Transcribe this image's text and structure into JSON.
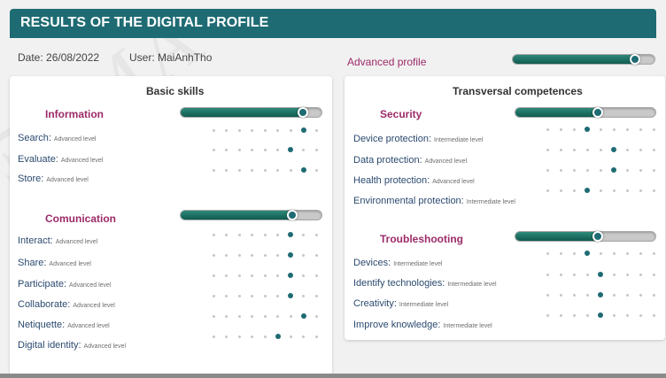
{
  "header": {
    "title": "RESULTS OF THE DIGITAL PROFILE"
  },
  "meta": {
    "date": "Date: 26/08/2022",
    "user": "User: MaiAnhTho"
  },
  "profile": {
    "label": "Advanced profile",
    "level": 0.86
  },
  "colors": {
    "header": "#1e6b73",
    "accent": "#9c2b68",
    "bar": "#0f5b50",
    "text": "#2b4a6f"
  },
  "left_panel": {
    "title": "Basic skills",
    "sections": [
      {
        "title": "Information",
        "bar_level": 0.87,
        "items": [
          {
            "name": "Search:",
            "level": "Advanced level",
            "dot": 8
          },
          {
            "name": "Evaluate:",
            "level": "Advanced level",
            "dot": 7
          },
          {
            "name": "Store:",
            "level": "Advanced level",
            "dot": 8
          }
        ]
      },
      {
        "title": "Comunication",
        "bar_level": 0.79,
        "items": [
          {
            "name": "Interact:",
            "level": "Advanced level",
            "dot": 7
          },
          {
            "name": "Share:",
            "level": "Advanced level",
            "dot": 7
          },
          {
            "name": "Participate:",
            "level": "Advanced level",
            "dot": 7
          },
          {
            "name": "Collaborate:",
            "level": "Advanced level",
            "dot": 7
          },
          {
            "name": "Netiquette:",
            "level": "Advanced level",
            "dot": 8
          },
          {
            "name": "Digital identity:",
            "level": "Advanced level",
            "dot": 6
          }
        ]
      }
    ]
  },
  "right_panel": {
    "title": "Transversal competences",
    "sections": [
      {
        "title": "Security",
        "bar_level": 0.59,
        "items": [
          {
            "name": "Device protection:",
            "level": "Intermediate level",
            "dot": 4
          },
          {
            "name": "Data protection:",
            "level": "Advanced level",
            "dot": 6
          },
          {
            "name": "Health protection:",
            "level": "Advanced level",
            "dot": 6
          },
          {
            "name": "Environmental protection:",
            "level": "Intermediate level",
            "dot": 4
          }
        ]
      },
      {
        "title": "Troubleshooting",
        "bar_level": 0.59,
        "items": [
          {
            "name": "Devices:",
            "level": "Intermediate level",
            "dot": 4
          },
          {
            "name": "Identify technologies:",
            "level": "Intermediate level",
            "dot": 5
          },
          {
            "name": "Creativity:",
            "level": "Intermediate level",
            "dot": 5
          },
          {
            "name": "Improve knowledge:",
            "level": "Intermediate level",
            "dot": 5
          }
        ]
      }
    ]
  }
}
